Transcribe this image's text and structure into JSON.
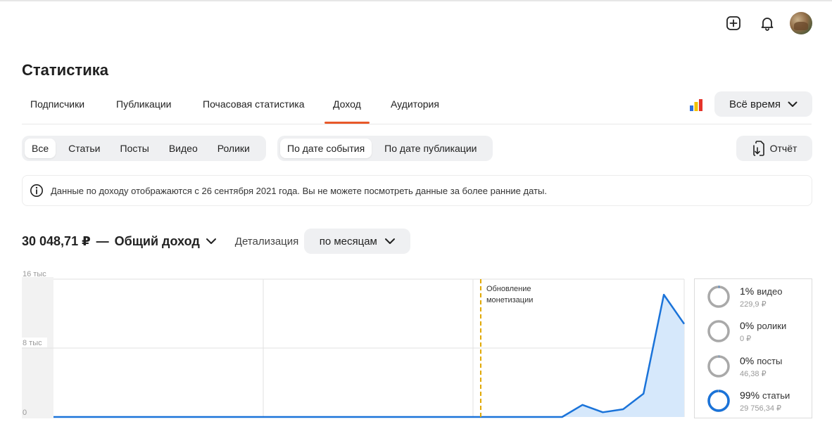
{
  "header": {
    "title": "Статистика"
  },
  "tabs": [
    {
      "label": "Подписчики",
      "active": false
    },
    {
      "label": "Публикации",
      "active": false
    },
    {
      "label": "Почасовая статистика",
      "active": false
    },
    {
      "label": "Доход",
      "active": true
    },
    {
      "label": "Аудитория",
      "active": false
    }
  ],
  "period": {
    "label": "Всё время",
    "logo_colors": [
      "#2e6fde",
      "#f2c200",
      "#e5332a"
    ]
  },
  "type_filter": [
    {
      "label": "Все",
      "active": true
    },
    {
      "label": "Статьи",
      "active": false
    },
    {
      "label": "Посты",
      "active": false
    },
    {
      "label": "Видео",
      "active": false
    },
    {
      "label": "Ролики",
      "active": false
    }
  ],
  "date_filter": [
    {
      "label": "По дате события",
      "active": true
    },
    {
      "label": "По дате публикации",
      "active": false
    }
  ],
  "report_button": "Отчёт",
  "info_text": "Данные по доходу отображаются с 26 сентября 2021 года. Вы не можете посмотреть данные за более ранние даты.",
  "total": {
    "value": "30 048,71 ₽",
    "label": "Общий доход",
    "separator": "—"
  },
  "detail": {
    "label": "Детализация",
    "value": "по месяцам"
  },
  "chart_data": {
    "type": "area",
    "yticks": [
      "16 тыс",
      "8 тыс",
      "0"
    ],
    "ylim": [
      0,
      16000
    ],
    "values": [
      0,
      0,
      0,
      0,
      0,
      0,
      0,
      0,
      0,
      0,
      0,
      0,
      0,
      0,
      0,
      0,
      0,
      0,
      0,
      0,
      0,
      0,
      0,
      0,
      0,
      0,
      1400,
      550,
      900,
      2700,
      14200,
      10800
    ],
    "annotation": "Обновление монетизации",
    "annotation_index": 21,
    "line_color": "#1a73d9",
    "fill_color": "#d6e8fb",
    "annotation_color": "#e0a800"
  },
  "legend": [
    {
      "pct": "1%",
      "name": "видео",
      "amount": "229,9 ₽",
      "fraction": 0.01
    },
    {
      "pct": "0%",
      "name": "ролики",
      "amount": "0 ₽",
      "fraction": 0.0
    },
    {
      "pct": "0%",
      "name": "посты",
      "amount": "46,38 ₽",
      "fraction": 0.002
    },
    {
      "pct": "99%",
      "name": "статьи",
      "amount": "29 756,34 ₽",
      "fraction": 0.99
    }
  ]
}
